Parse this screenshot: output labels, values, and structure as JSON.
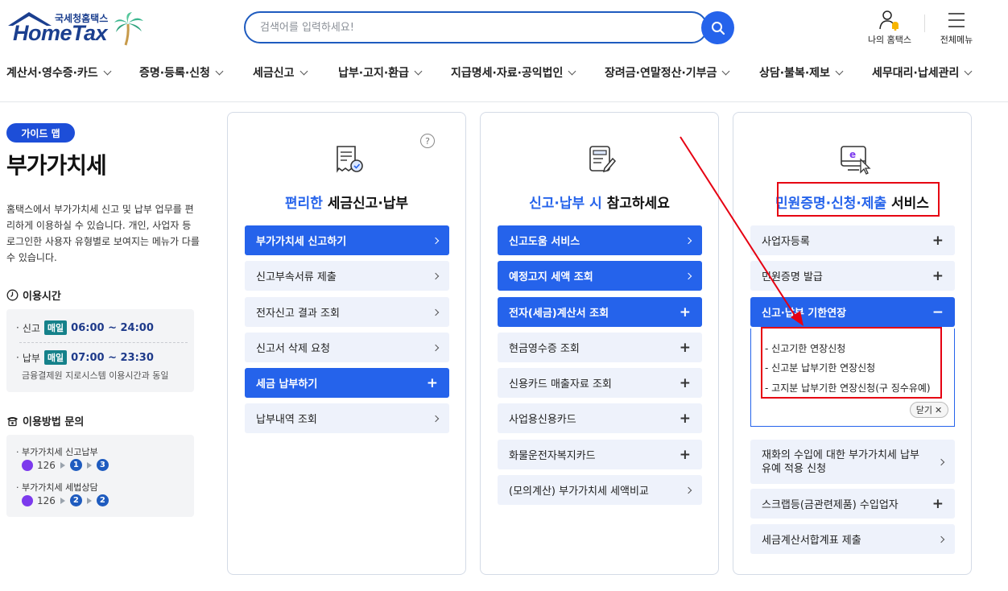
{
  "header": {
    "logo_kr": "국세청홈택스",
    "logo_en": "HomeTax",
    "search_placeholder": "검색어를 입력하세요!",
    "my_hometax": "나의 홈택스",
    "all_menu": "전체메뉴"
  },
  "nav": [
    "계산서·영수증·카드",
    "증명·등록·신청",
    "세금신고",
    "납부·고지·환급",
    "지급명세·자료·공익법인",
    "장려금·연말정산·기부금",
    "상담·불복·제보",
    "세무대리·납세관리"
  ],
  "sidebar": {
    "badge": "가이드 맵",
    "title": "부가가치세",
    "description": "홈택스에서 부가가치세 신고 및 납부 업무를 편리하게 이용하실 수 있습니다. 개인, 사업자 등 로그인한 사용자 유형별로 보여지는 메뉴가 다를 수 있습니다.",
    "hours_title": "이용시간",
    "hours": [
      {
        "label": "신고",
        "badge": "매일",
        "time": "06:00 ~ 24:00"
      },
      {
        "label": "납부",
        "badge": "매일",
        "time": "07:00 ~ 23:30"
      }
    ],
    "hours_note": "금융결제원 지로시스템 이용시간과 동일",
    "inquiry_title": "이용방법 문의",
    "inquiries": [
      {
        "label": "부가가치세 신고납부",
        "phone": "126",
        "steps": [
          "1",
          "3"
        ]
      },
      {
        "label": "부가가치세 세법상담",
        "phone": "126",
        "steps": [
          "2",
          "2"
        ]
      }
    ]
  },
  "cards": {
    "c1": {
      "title_hl": "편리한",
      "title_rest": " 세금신고·납부",
      "items": [
        "부가가치세 신고하기",
        "신고부속서류 제출",
        "전자신고 결과 조회",
        "신고서 삭제 요청",
        "세금 납부하기",
        "납부내역 조회"
      ]
    },
    "c2": {
      "title_hl": "신고·납부 시",
      "title_rest": " 참고하세요",
      "items": [
        "신고도움 서비스",
        "예정고지 세액 조회",
        "전자(세금)계산서 조회",
        "현금영수증 조회",
        "신용카드 매출자료 조회",
        "사업용신용카드",
        "화물운전자복지카드",
        "(모의계산) 부가가치세 세액비교"
      ]
    },
    "c3": {
      "title_hl": "민원증명·신청·제출",
      "title_rest": " 서비스",
      "items": [
        "사업자등록",
        "민원증명 발급",
        "신고·납부 기한연장",
        "재화의 수입에 대한 부가가치세 납부유예 적용 신청",
        "스크랩등(금관련제품) 수입업자",
        "세금계산서합계표 제출"
      ],
      "sub_items": [
        "신고기한 연장신청",
        "신고분 납부기한 연장신청",
        "고지분 납부기한 연장신청(구 징수유예)"
      ],
      "close_label": "닫기"
    }
  },
  "colors": {
    "primary": "#2563eb",
    "light_button": "#eef2fb",
    "annotation_red": "#e60012",
    "logo_blue": "#1b3f8f"
  }
}
